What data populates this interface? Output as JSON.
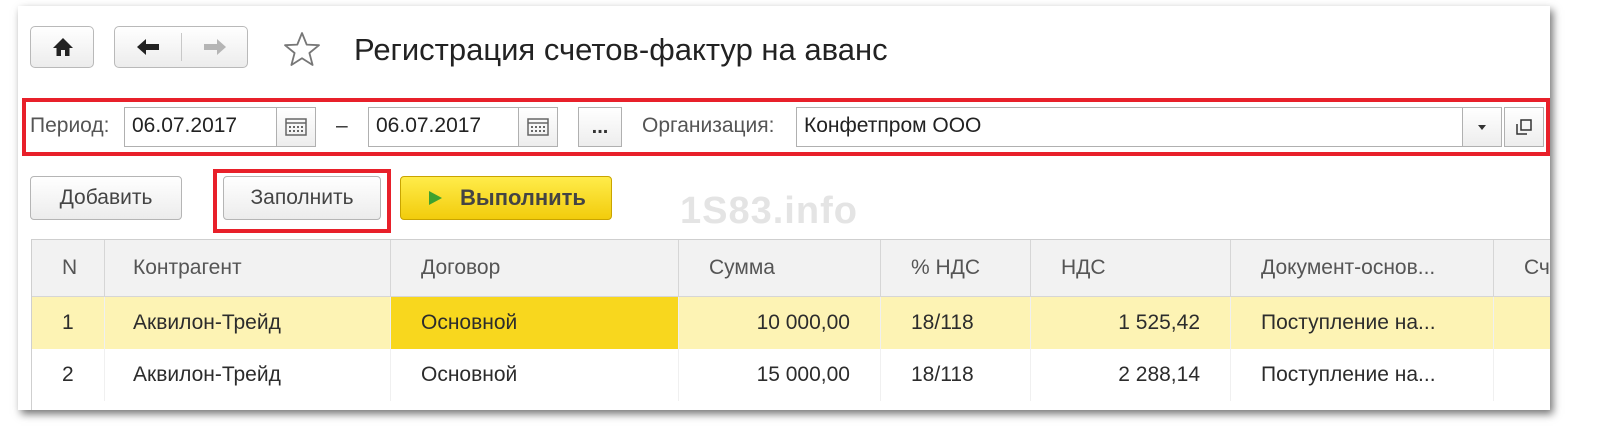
{
  "window": {
    "title": "Регистрация счетов-фактур на аванс"
  },
  "nav": {
    "home_icon": "home-icon",
    "back_icon": "arrow-left-icon",
    "forward_icon": "arrow-right-icon",
    "favorite_icon": "star-icon"
  },
  "filter": {
    "period_label": "Период:",
    "date_from": "06.07.2017",
    "dash": "–",
    "date_to": "06.07.2017",
    "more_label": "...",
    "org_label": "Организация:",
    "org_value": "Конфетпром ООО"
  },
  "commands": {
    "add": "Добавить",
    "fill": "Заполнить",
    "run": "Выполнить"
  },
  "watermark": "1S83.info",
  "table": {
    "columns": [
      "N",
      "Контрагент",
      "Договор",
      "Сумма",
      "% НДС",
      "НДС",
      "Документ-основ...",
      "Сч"
    ],
    "rows": [
      [
        "1",
        "Аквилон-Трейд",
        "Основной",
        "10 000,00",
        "18/118",
        "1 525,42",
        "Поступление на...",
        ""
      ],
      [
        "2",
        "Аквилон-Трейд",
        "Основной",
        "15 000,00",
        "18/118",
        "2 288,14",
        "Поступление на...",
        ""
      ]
    ]
  },
  "colors": {
    "highlight_border": "#e8202a",
    "selected_row": "#fdf3b4",
    "current_cell": "#f8d71e",
    "run_button": "#f2cc0c"
  }
}
